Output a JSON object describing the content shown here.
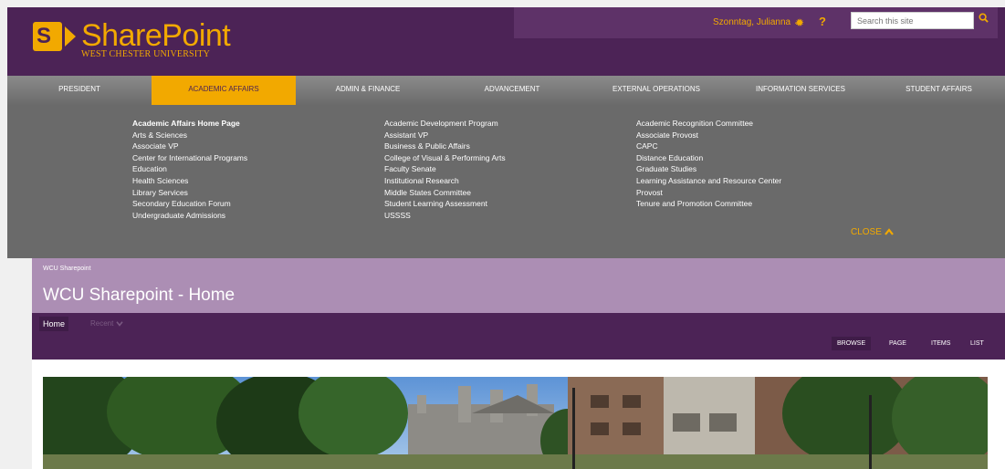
{
  "header": {
    "brand_title": "SharePoint",
    "brand_subtitle": "WEST CHESTER UNIVERSITY",
    "brand_letter": "S",
    "user_name": "Szonntag, Julianna",
    "user_caret": "⌄",
    "help_label": "?",
    "search_placeholder": "Search this site",
    "accent_color": "#f2a900",
    "purple_color": "#4c2356"
  },
  "nav": {
    "items": [
      {
        "label": "PRESIDENT"
      },
      {
        "label": "ACADEMIC AFFAIRS"
      },
      {
        "label": "ADMIN & FINANCE"
      },
      {
        "label": "ADVANCEMENT"
      },
      {
        "label": "EXTERNAL OPERATIONS"
      },
      {
        "label": "INFORMATION SERVICES"
      },
      {
        "label": "STUDENT AFFAIRS"
      }
    ],
    "active": "ACADEMIC AFFAIRS"
  },
  "mega_menu": {
    "columns": [
      [
        "Academic Affairs Home Page",
        "Arts & Sciences",
        "Associate VP",
        "Center for International Programs",
        "Education",
        "Health Sciences",
        "Library Services",
        "Secondary Education Forum",
        "Undergraduate Admissions"
      ],
      [
        "Academic Development Program",
        "Assistant VP",
        "Business & Public Affairs",
        "College of Visual & Performing Arts",
        "Faculty Senate",
        "Institutional Research",
        "Middle States Committee",
        "Student Learning Assessment",
        "USSSS"
      ],
      [
        "Academic Recognition Committee",
        "Associate Provost",
        "CAPC",
        "Distance Education",
        "Graduate Studies",
        "Learning Assistance and Resource Center",
        "Provost",
        "Tenure and Promotion Committee"
      ]
    ],
    "close_label": "CLOSE"
  },
  "page": {
    "breadcrumb": "WCU Sharepoint",
    "title": "WCU Sharepoint - Home",
    "home_tab": "Home",
    "recent_label": "Recent",
    "ribbon": [
      "BROWSE",
      "PAGE",
      "ITEMS",
      "LIST"
    ]
  }
}
